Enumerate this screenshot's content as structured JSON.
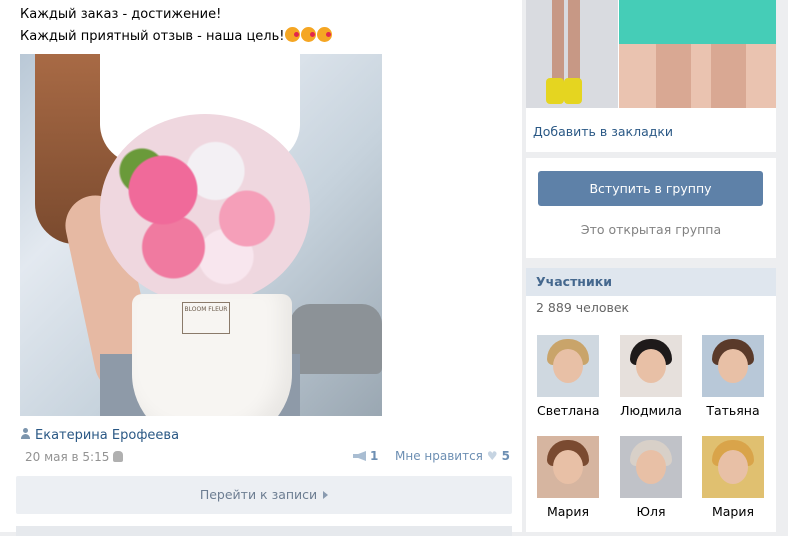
{
  "post": {
    "line1": "Каждый заказ - достижение!",
    "line2": "Каждый приятный отзыв - наша цель!",
    "emojis": [
      "kissing-face-icon",
      "kissing-face-icon",
      "kissing-face-icon"
    ],
    "photo_logo": "BLOOM FLEUR",
    "author": "Екатерина Ерофеева",
    "date": "20 мая в 5:15",
    "shares": "1",
    "like_label": "Мне нравится",
    "likes": "5",
    "goto_label": "Перейти к записи"
  },
  "sidebar": {
    "bookmark_label": "Добавить в закладки",
    "join_label": "Вступить в группу",
    "open_group_label": "Это открытая группа",
    "members_title": "Участники",
    "members_count": "2 889 человек",
    "members": [
      {
        "name": "Светлана",
        "bg": "#cfd8e0",
        "hair": "#c9a46a"
      },
      {
        "name": "Людмила",
        "bg": "#e6e0dc",
        "hair": "#1e1a1a"
      },
      {
        "name": "Татьяна",
        "bg": "#b8c8d8",
        "hair": "#5a3a2a"
      },
      {
        "name": "Мария",
        "bg": "#d6b5a0",
        "hair": "#7a4a30"
      },
      {
        "name": "Юля",
        "bg": "#c0c2c8",
        "hair": "#d8d0c8"
      },
      {
        "name": "Мария",
        "bg": "#e0c070",
        "hair": "#d9a44a"
      }
    ]
  },
  "colors": {
    "link": "#2a5885",
    "button": "#5e81a8",
    "header_bg": "#dfe6ee",
    "page_bg": "#edeef0"
  }
}
